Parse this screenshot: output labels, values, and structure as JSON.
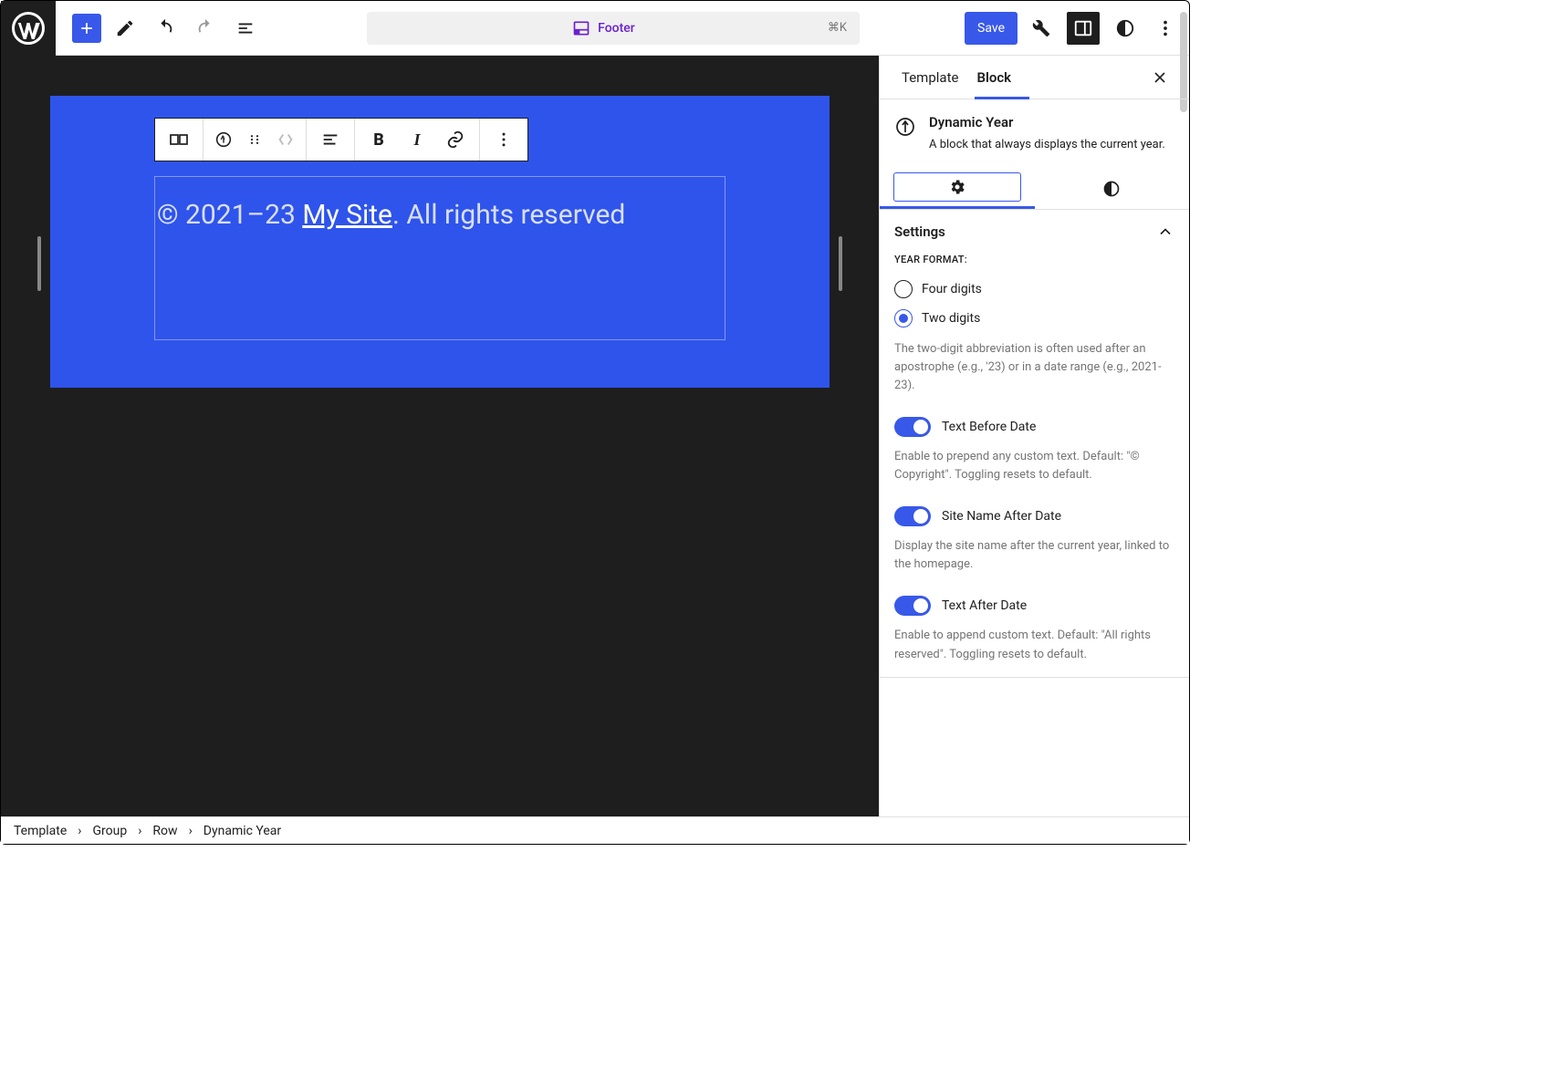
{
  "topbar": {
    "document_label": "Footer",
    "shortcut": "⌘K",
    "save": "Save"
  },
  "canvas": {
    "prefix": "© 2021–23 ",
    "site_link": "My Site",
    "suffix": ". All rights reserved"
  },
  "sidebar": {
    "tabs": {
      "template": "Template",
      "block": "Block"
    },
    "block": {
      "title": "Dynamic Year",
      "desc": "A block that always displays the current year."
    },
    "settings": {
      "heading": "Settings",
      "year_format_label": "YEAR FORMAT:",
      "four": "Four digits",
      "two": "Two digits",
      "year_help": "The two-digit abbreviation is often used after an apostrophe (e.g., '23) or in a date range (e.g., 2021-23).",
      "before": {
        "label": "Text Before Date",
        "help": "Enable to prepend any custom text. Default: \"© Copyright\". Toggling resets to default."
      },
      "siteName": {
        "label": "Site Name After Date",
        "help": "Display the site name after the current year, linked to the homepage."
      },
      "after": {
        "label": "Text After Date",
        "help": "Enable to append custom text. Default: \"All rights reserved\". Toggling resets to default."
      }
    }
  },
  "breadcrumb": [
    "Template",
    "Group",
    "Row",
    "Dynamic Year"
  ]
}
